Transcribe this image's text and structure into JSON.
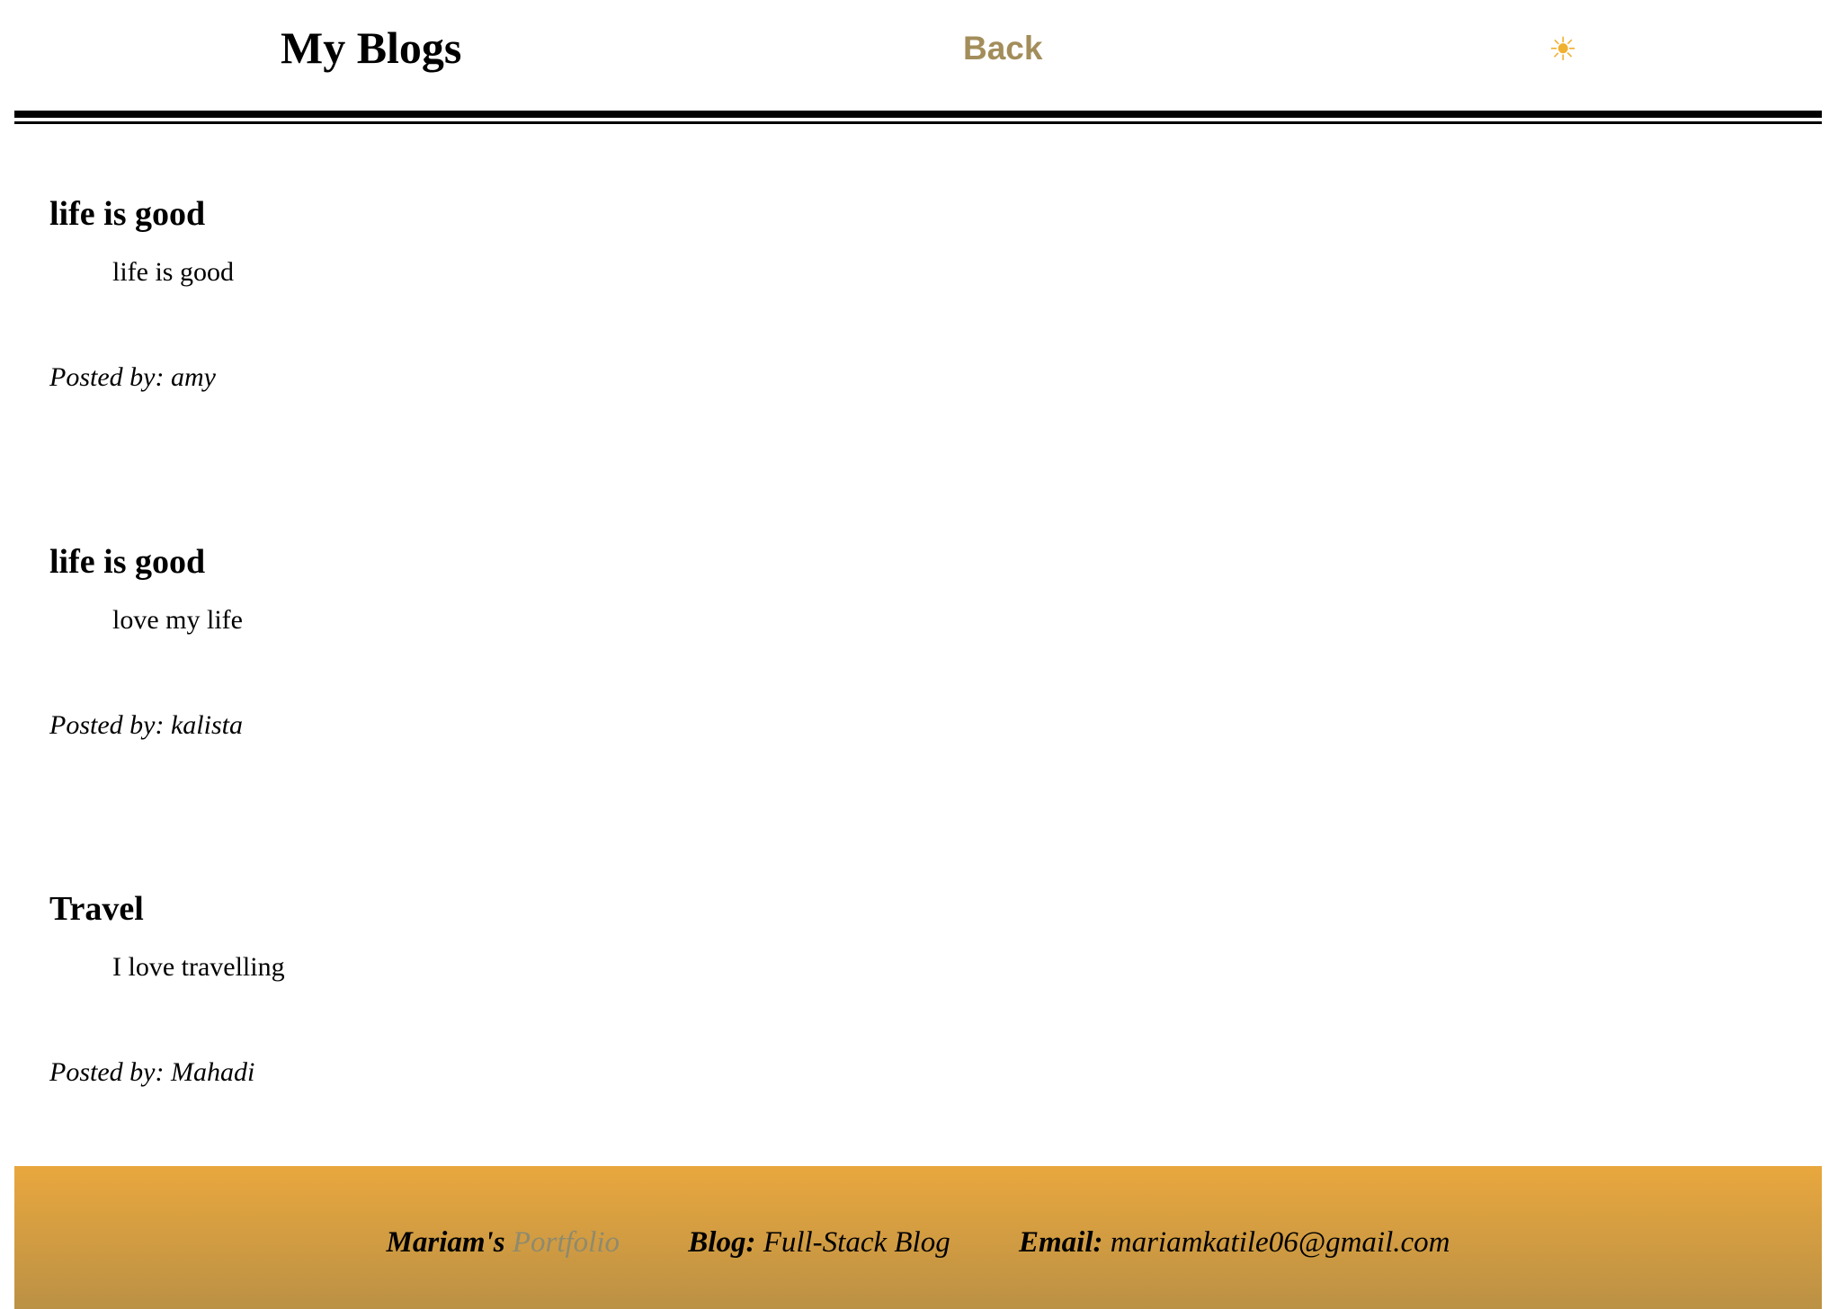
{
  "header": {
    "title": "My Blogs",
    "back_label": "Back",
    "theme_icon": "sun-icon"
  },
  "posts": [
    {
      "title": "life is good",
      "body": "life is good",
      "posted_by": "Posted by: amy"
    },
    {
      "title": "life is good",
      "body": "love my life",
      "posted_by": "Posted by: kalista"
    },
    {
      "title": "Travel",
      "body": "I love travelling",
      "posted_by": "Posted by: Mahadi"
    }
  ],
  "footer": {
    "owner": "Mariam's",
    "portfolio_link": "Portfolio",
    "blog_label": "Blog:",
    "blog_value": "Full-Stack Blog",
    "email_label": "Email:",
    "email_value": "mariamkatile06@gmail.com"
  },
  "colors": {
    "back": "#a38d5a",
    "footer_top": "#e9a73e",
    "footer_bottom": "#bb9145"
  }
}
